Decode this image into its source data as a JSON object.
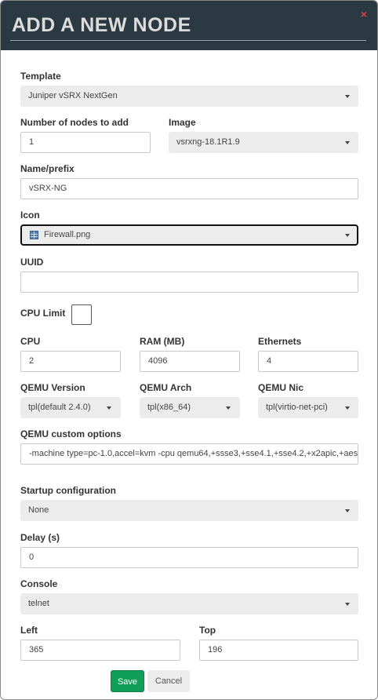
{
  "dialog": {
    "title": "ADD A NEW NODE",
    "close_label": "×"
  },
  "template": {
    "label": "Template",
    "value": "Juniper vSRX NextGen"
  },
  "nodes_count": {
    "label": "Number of nodes to add",
    "value": "1"
  },
  "image": {
    "label": "Image",
    "value": "vsrxng-18.1R1.9"
  },
  "name_prefix": {
    "label": "Name/prefix",
    "value": "vSRX-NG"
  },
  "icon": {
    "label": "Icon",
    "value": "Firewall.png",
    "icon_name": "firewall-icon"
  },
  "uuid": {
    "label": "UUID",
    "value": ""
  },
  "cpu_limit": {
    "label": "CPU Limit",
    "checked": false
  },
  "cpu": {
    "label": "CPU",
    "value": "2"
  },
  "ram": {
    "label": "RAM (MB)",
    "value": "4096"
  },
  "ethernets": {
    "label": "Ethernets",
    "value": "4"
  },
  "qemu_version": {
    "label": "QEMU Version",
    "value": "tpl(default 2.4.0)"
  },
  "qemu_arch": {
    "label": "QEMU Arch",
    "value": "tpl(x86_64)"
  },
  "qemu_nic": {
    "label": "QEMU Nic",
    "value": "tpl(virtio-net-pci)"
  },
  "qemu_custom": {
    "label": "QEMU custom options",
    "value": "-machine type=pc-1.0,accel=kvm -cpu qemu64,+ssse3,+sse4.1,+sse4.2,+x2apic,+aes"
  },
  "startup_config": {
    "label": "Startup configuration",
    "value": "None"
  },
  "delay": {
    "label": "Delay (s)",
    "value": "0"
  },
  "console": {
    "label": "Console",
    "value": "telnet"
  },
  "left": {
    "label": "Left",
    "value": "365"
  },
  "top": {
    "label": "Top",
    "value": "196"
  },
  "buttons": {
    "save": "Save",
    "cancel": "Cancel"
  },
  "colors": {
    "header_bg": "#2b3a42",
    "save_green": "#0f9d58",
    "close_red": "#e03b3b"
  }
}
